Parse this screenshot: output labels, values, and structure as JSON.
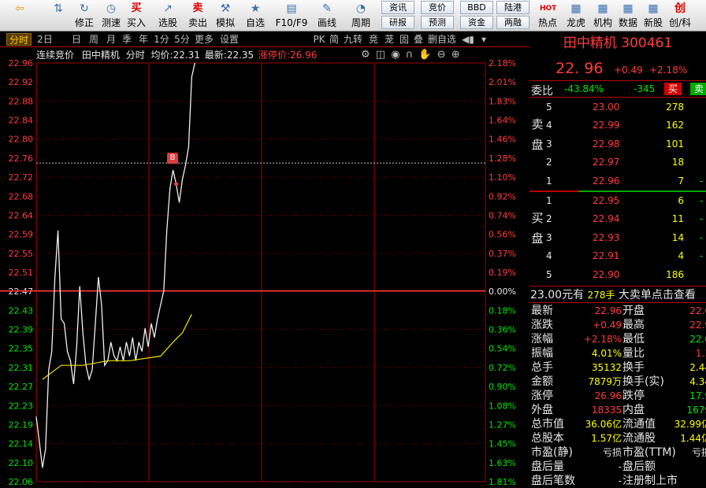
{
  "toolbar": {
    "items": [
      {
        "label": "",
        "icon": "back-arrow-icon"
      },
      {
        "label": "",
        "icon": "up-down-icon"
      },
      {
        "label": "修正",
        "icon": "refresh-icon"
      },
      {
        "label": "测速",
        "icon": "clock-icon"
      },
      {
        "label": "买入",
        "icon": "buy-icon",
        "glyph": "买"
      },
      {
        "label": "选股",
        "icon": "select-stock-icon"
      },
      {
        "label": "卖出",
        "icon": "sell-icon",
        "glyph": "卖"
      },
      {
        "label": "模拟",
        "icon": "hammer-icon"
      },
      {
        "label": "自选",
        "icon": "star-icon"
      },
      {
        "label": "F10/F9",
        "icon": "f10-icon"
      },
      {
        "label": "画线",
        "icon": "pencil-icon"
      },
      {
        "label": "周期",
        "icon": "period-icon"
      }
    ],
    "small_buttons": [
      "资讯",
      "研报",
      "竞价",
      "预测",
      "BBD",
      "资金",
      "陆港",
      "两融"
    ],
    "right_items": [
      {
        "label": "热点",
        "icon": "hot-icon",
        "glyph": "HOT"
      },
      {
        "label": "龙虎",
        "icon": "dragon-icon"
      },
      {
        "label": "机构",
        "icon": "institution-icon"
      },
      {
        "label": "数据",
        "icon": "data-icon"
      },
      {
        "label": "新股",
        "icon": "new-stock-icon"
      },
      {
        "label": "创/科",
        "icon": "star-market-icon",
        "glyph": "创"
      }
    ]
  },
  "tabs": [
    "分时",
    "2日",
    "日",
    "周",
    "月",
    "季",
    "年",
    "1分",
    "5分",
    "更多",
    "设置"
  ],
  "tabs_right": [
    "PK",
    "简",
    "九转",
    "竞",
    "茏",
    "固",
    "叠",
    "删自选"
  ],
  "chart_header": {
    "mode": "连续竞价",
    "name": "田中精机",
    "type": "分时",
    "avg_label": "均价:",
    "avg": "22.31",
    "latest_label": "最新:",
    "latest": "22.35",
    "limit_label": "涨停价:",
    "limit": "26.96"
  },
  "marker": "B",
  "chart_data": {
    "type": "line",
    "prev_close": 22.47,
    "y_ticks": [
      "22.96",
      "22.92",
      "22.88",
      "22.84",
      "22.80",
      "22.76",
      "22.72",
      "22.68",
      "22.64",
      "22.59",
      "22.55",
      "22.51",
      "22.47",
      "22.43",
      "22.39",
      "22.35",
      "22.31",
      "22.27",
      "22.23",
      "22.19",
      "22.14",
      "22.10",
      "22.06"
    ],
    "pct_ticks": [
      "2.18%",
      "2.01%",
      "1.83%",
      "1.64%",
      "1.46%",
      "1.28%",
      "1.10%",
      "0.92%",
      "0.74%",
      "0.56%",
      "0.37%",
      "0.19%",
      "0.00%",
      "0.18%",
      "0.36%",
      "0.54%",
      "0.72%",
      "0.90%",
      "1.08%",
      "1.27%",
      "1.45%",
      "1.63%",
      "1.81%"
    ],
    "ylim": [
      22.06,
      22.96
    ],
    "price_series": [
      [
        0,
        22.2
      ],
      [
        2,
        22.09
      ],
      [
        3,
        22.13
      ],
      [
        4,
        22.3
      ],
      [
        5,
        22.34
      ],
      [
        6,
        22.5
      ],
      [
        7,
        22.6
      ],
      [
        8,
        22.41
      ],
      [
        9,
        22.4
      ],
      [
        10,
        22.34
      ],
      [
        11,
        22.32
      ],
      [
        12,
        22.27
      ],
      [
        13,
        22.35
      ],
      [
        14,
        22.48
      ],
      [
        15,
        22.38
      ],
      [
        16,
        22.31
      ],
      [
        17,
        22.28
      ],
      [
        18,
        22.3
      ],
      [
        19,
        22.4
      ],
      [
        20,
        22.5
      ],
      [
        21,
        22.44
      ],
      [
        22,
        22.31
      ],
      [
        23,
        22.32
      ],
      [
        24,
        22.36
      ],
      [
        25,
        22.33
      ],
      [
        26,
        22.32
      ],
      [
        27,
        22.35
      ],
      [
        28,
        22.32
      ],
      [
        29,
        22.36
      ],
      [
        30,
        22.33
      ],
      [
        31,
        22.37
      ],
      [
        32,
        22.32
      ],
      [
        33,
        22.36
      ],
      [
        34,
        22.34
      ],
      [
        35,
        22.39
      ],
      [
        36,
        22.35
      ],
      [
        37,
        22.4
      ],
      [
        38,
        22.37
      ],
      [
        39,
        22.41
      ],
      [
        40,
        22.44
      ],
      [
        41,
        22.47
      ],
      [
        42,
        22.6
      ],
      [
        43,
        22.69
      ],
      [
        44,
        22.73
      ],
      [
        45,
        22.7
      ],
      [
        46,
        22.66
      ],
      [
        47,
        22.71
      ],
      [
        48,
        22.74
      ],
      [
        49,
        22.78
      ],
      [
        50,
        22.93
      ],
      [
        51,
        22.96
      ]
    ],
    "avg_series": [
      [
        2,
        22.28
      ],
      [
        8,
        22.31
      ],
      [
        15,
        22.31
      ],
      [
        23,
        22.32
      ],
      [
        30,
        22.32
      ],
      [
        40,
        22.33
      ],
      [
        44,
        22.36
      ],
      [
        47,
        22.38
      ],
      [
        50,
        22.42
      ]
    ]
  },
  "quote": {
    "name_code": "田中精机 300461",
    "price": "22. 96",
    "change": "+0.49",
    "pct": "+2.18%",
    "weibi_label": "委比",
    "weibi": "-43.84%",
    "weicha": "-345",
    "buy_btn": "买",
    "sell_btn": "卖",
    "sell_side_label": "卖盘",
    "buy_side_label": "买盘",
    "asks": [
      {
        "lvl": "5",
        "price": "23.00",
        "vol": "278"
      },
      {
        "lvl": "4",
        "price": "22.99",
        "vol": "162"
      },
      {
        "lvl": "3",
        "price": "22.98",
        "vol": "101"
      },
      {
        "lvl": "2",
        "price": "22.97",
        "vol": "18"
      },
      {
        "lvl": "1",
        "price": "22.96",
        "vol": "7",
        "chg": "-"
      }
    ],
    "bids": [
      {
        "lvl": "1",
        "price": "22.95",
        "vol": "6",
        "chg": "-"
      },
      {
        "lvl": "2",
        "price": "22.94",
        "vol": "11",
        "chg": "-"
      },
      {
        "lvl": "3",
        "price": "22.93",
        "vol": "14",
        "chg": "-"
      },
      {
        "lvl": "4",
        "price": "22.91",
        "vol": "4",
        "chg": "-"
      },
      {
        "lvl": "5",
        "price": "22.90",
        "vol": "186",
        "chg": ""
      }
    ],
    "big_order": {
      "price": "23.00",
      "unit1": "元有",
      "vol": "278手",
      "text": "大卖单点击查看"
    },
    "stats": [
      {
        "l1": "最新",
        "v1": "22.96",
        "c1": "red",
        "l2": "开盘",
        "v2": "22.6",
        "c2": "red"
      },
      {
        "l1": "涨跌",
        "v1": "+0.49",
        "c1": "red",
        "l2": "最高",
        "v2": "22.9",
        "c2": "red"
      },
      {
        "l1": "涨幅",
        "v1": "+2.18%",
        "c1": "red",
        "l2": "最低",
        "v2": "22.0",
        "c2": "grn"
      },
      {
        "l1": "振幅",
        "v1": "4.01%",
        "c1": "yel",
        "l2": "量比",
        "v2": "1.3",
        "c2": "red"
      },
      {
        "l1": "总手",
        "v1": "35132",
        "c1": "yel",
        "l2": "换手",
        "v2": "2.44",
        "c2": "yel"
      },
      {
        "l1": "金额",
        "v1": "7879万",
        "c1": "yel",
        "l2": "换手(实)",
        "v2": "4.34",
        "c2": "yel"
      },
      {
        "l1": "涨停",
        "v1": "26.96",
        "c1": "red",
        "l2": "跌停",
        "v2": "17.9",
        "c2": "grn"
      },
      {
        "l1": "外盘",
        "v1": "18335",
        "c1": "red",
        "l2": "内盘",
        "v2": "1679",
        "c2": "grn"
      },
      {
        "l1": "总市值",
        "v1": "36.06亿",
        "c1": "yel",
        "l2": "流通值",
        "v2": "32.99亿",
        "c2": "yel"
      },
      {
        "l1": "总股本",
        "v1": "1.57亿",
        "c1": "yel",
        "l2": "流通股",
        "v2": "1.44亿",
        "c2": "yel"
      },
      {
        "l1": "市盈(静)",
        "v1": "亏损",
        "c1": "wht",
        "l2": "市盈(TTM)",
        "v2": "亏损",
        "c2": "wht"
      },
      {
        "l1": "盘后量",
        "v1": "-",
        "c1": "wht",
        "l2": "盘后额",
        "v2": "-",
        "c2": "wht"
      },
      {
        "l1": "盘后笔数",
        "v1": "-",
        "c1": "wht",
        "l2": "注册制上市",
        "v2": "",
        "c2": "wht"
      }
    ]
  }
}
